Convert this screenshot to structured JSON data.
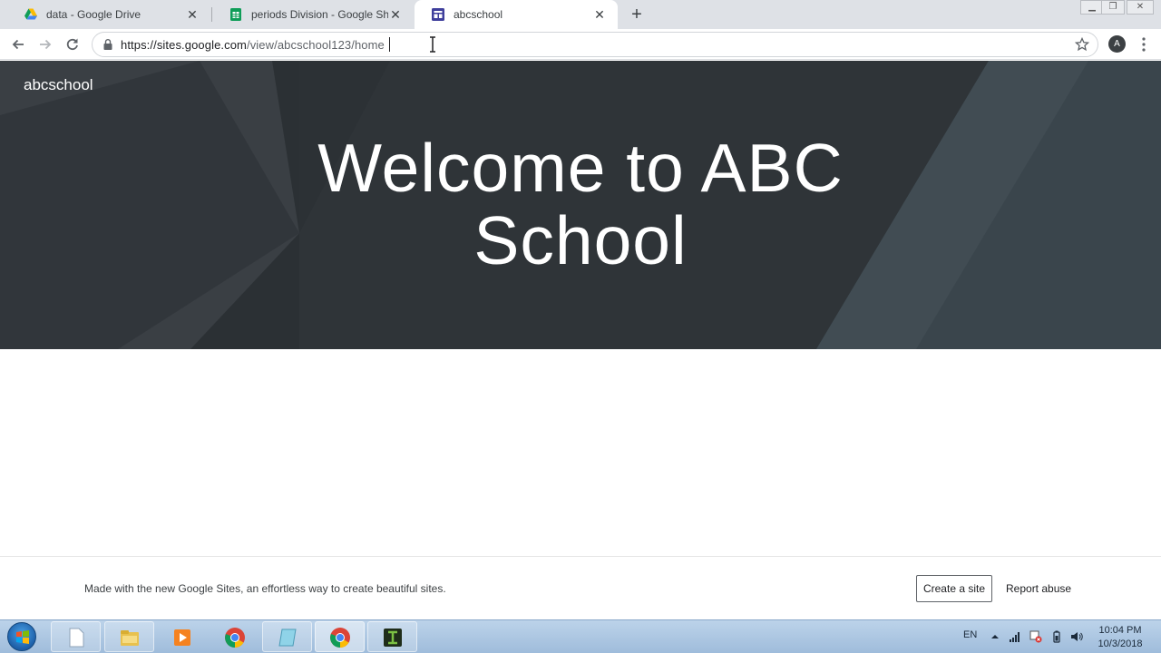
{
  "browser": {
    "tabs": [
      {
        "title": "data - Google Drive",
        "icon": "google-drive-icon",
        "active": false
      },
      {
        "title": "periods Division - Google Sheets",
        "icon": "google-sheets-icon",
        "active": false
      },
      {
        "title": "abcschool",
        "icon": "google-sites-icon",
        "active": true
      }
    ],
    "url_host": "https://sites.google.com",
    "url_path": "/view/abcschool123/home",
    "profile_initial": "A"
  },
  "site": {
    "name": "abcschool",
    "hero_title_line1": "Welcome to ABC",
    "hero_title_line2": "School"
  },
  "footer": {
    "text": "Made with the new Google Sites, an effortless way to create beautiful sites.",
    "create_label": "Create a site",
    "report_label": "Report abuse"
  },
  "taskbar": {
    "items": [
      "blank-document-icon",
      "file-explorer-icon",
      "media-player-icon",
      "chrome-icon",
      "notepad-icon",
      "chrome-icon",
      "camtasia-icon"
    ],
    "language": "EN",
    "time": "10:04 PM",
    "date": "10/3/2018"
  },
  "colors": {
    "hero_bg": "#2f3438",
    "tabstrip_bg": "#dee1e6",
    "taskbar_bg": "#9fbcdb"
  }
}
